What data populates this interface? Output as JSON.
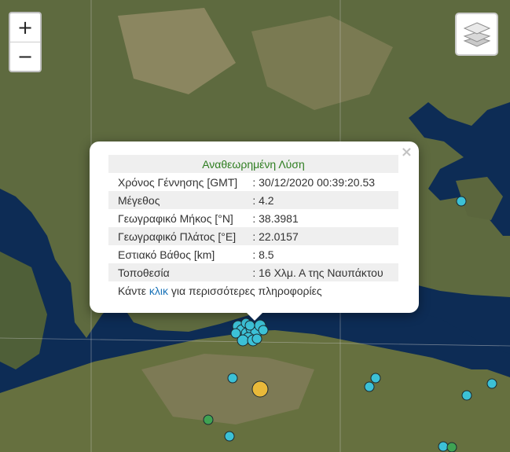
{
  "zoom": {
    "in_label": "+",
    "out_label": "−"
  },
  "layers": {
    "icon": "layers-icon"
  },
  "popup": {
    "title": "Αναθεωρημένη Λύση",
    "close_label": "×",
    "rows": [
      {
        "label": "Χρόνος Γέννησης [GMT]",
        "value": ": 30/12/2020 00:39:20.53"
      },
      {
        "label": "Μέγεθος",
        "value": ": 4.2"
      },
      {
        "label": "Γεωγραφικό Μήκος [°N]",
        "value": ": 38.3981"
      },
      {
        "label": "Γεωγραφικό Πλάτος [°E]",
        "value": ": 22.0157"
      },
      {
        "label": "Εστιακό Βάθος [km]",
        "value": ": 8.5"
      },
      {
        "label": "Τοποθεσία",
        "value": ": 16 Χλμ. Α της Ναυπάκτου"
      }
    ],
    "footer": {
      "before": "Κάντε ",
      "link": "κλικ",
      "after": " για περισσότερες πληροφορίες"
    }
  },
  "colors": {
    "sea": "#0d2c55",
    "land": "#5e6a3f",
    "marker_cyan": "#3cc1d6",
    "marker_green": "#3fa353",
    "marker_yellow": "#e8b93a",
    "heading_green": "#2e7d20",
    "link_blue": "#1a73b8"
  }
}
